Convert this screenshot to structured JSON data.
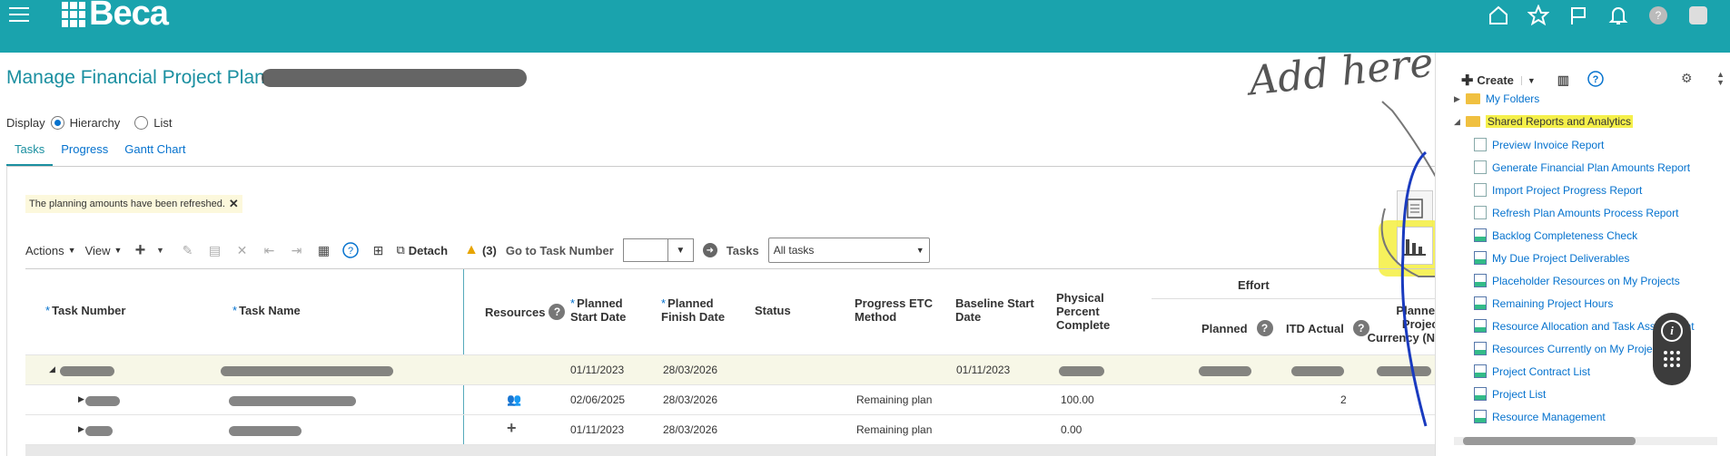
{
  "brand": {
    "name": "Beca",
    "color": "#1aa3ad"
  },
  "topbar": {
    "icons": [
      "menu-icon",
      "home-icon",
      "star-icon",
      "flag-icon",
      "bell-icon",
      "help-icon",
      "user-icon"
    ]
  },
  "page": {
    "title": "Manage Financial Project Plan"
  },
  "display": {
    "label": "Display",
    "options": [
      "Hierarchy",
      "List"
    ],
    "selected": "Hierarchy"
  },
  "tabs": [
    {
      "label": "Tasks",
      "active": true
    },
    {
      "label": "Progress",
      "active": false
    },
    {
      "label": "Gantt Chart",
      "active": false
    }
  ],
  "message": {
    "text": "The planning amounts have been refreshed."
  },
  "toolbar": {
    "actions": "Actions",
    "view": "View",
    "detach": "Detach",
    "warning_count": "(3)",
    "goto_label": "Go to Task Number",
    "goto_value": "",
    "tasks_label": "Tasks",
    "tasks_filter": "All tasks"
  },
  "grid": {
    "headers": {
      "task_number": "Task Number",
      "task_name": "Task Name",
      "resources": "Resources",
      "planned_start": "Planned Start Date",
      "planned_finish": "Planned Finish Date",
      "status": "Status",
      "progress_etc": "Progress ETC Method",
      "baseline_start": "Baseline Start Date",
      "physical_pct": "Physical Percent Complete",
      "effort_group": "Effort",
      "effort_planned": "Planned",
      "effort_itd": "ITD Actual",
      "planned_proj_currency": "Planned Project Currency (NZ"
    },
    "rows": [
      {
        "planned_start": "01/11/2023",
        "planned_finish": "28/03/2026",
        "progress_etc": "",
        "baseline_start": "01/11/2023",
        "physical_pct": "",
        "itd_actual": ""
      },
      {
        "planned_start": "02/06/2025",
        "planned_finish": "28/03/2026",
        "progress_etc": "Remaining plan",
        "baseline_start": "",
        "physical_pct": "100.00",
        "itd_actual": "2"
      },
      {
        "planned_start": "01/11/2023",
        "planned_finish": "28/03/2026",
        "progress_etc": "Remaining plan",
        "baseline_start": "",
        "physical_pct": "0.00",
        "itd_actual": ""
      }
    ]
  },
  "annotation": {
    "text": "Add here"
  },
  "side_panel": {
    "create_label": "Create",
    "folders": [
      {
        "label": "My Folders",
        "expanded": false
      },
      {
        "label": "Shared Reports and Analytics",
        "expanded": true
      }
    ],
    "reports": [
      {
        "label": "Preview Invoice Report",
        "type": "doc"
      },
      {
        "label": "Generate Financial Plan Amounts Report",
        "type": "doc"
      },
      {
        "label": "Import Project Progress Report",
        "type": "doc"
      },
      {
        "label": "Refresh Plan Amounts Process Report",
        "type": "doc"
      },
      {
        "label": "Backlog Completeness Check",
        "type": "chart"
      },
      {
        "label": "My Due Project Deliverables",
        "type": "chart"
      },
      {
        "label": "Placeholder Resources on My Projects",
        "type": "chart"
      },
      {
        "label": "Remaining Project Hours",
        "type": "chart"
      },
      {
        "label": "Resource Allocation and Task Assignment",
        "type": "chart"
      },
      {
        "label": "Resources Currently on My Projects",
        "type": "chart"
      },
      {
        "label": "Project Contract List",
        "type": "chart"
      },
      {
        "label": "Project List",
        "type": "chart"
      },
      {
        "label": "Resource Management",
        "type": "chart"
      }
    ]
  }
}
